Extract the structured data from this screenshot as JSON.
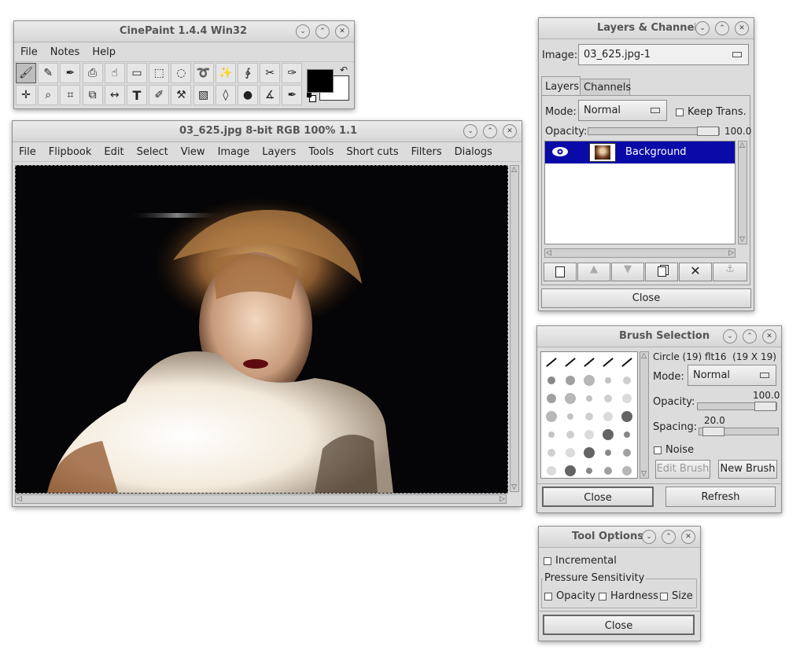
{
  "toolbox": {
    "title": "CinePaint 1.4.4 Win32",
    "menu": [
      "File",
      "Notes",
      "Help"
    ],
    "tools_row1": [
      "paintbrush-icon",
      "pencil-icon",
      "airbrush-icon",
      "clone-stamp-icon",
      "smudge-icon",
      "eraser-icon",
      "rect-select-icon",
      "ellipse-select-icon",
      "lasso-icon",
      "magic-wand-icon",
      "bezier-select-icon",
      "scissors-icon",
      "ink-pen-icon"
    ],
    "tools_row2": [
      "move-icon",
      "zoom-icon",
      "crop-icon",
      "transform-icon",
      "flip-icon",
      "text-icon",
      "color-picker-icon",
      "bucket-fill-icon",
      "gradient-icon",
      "blur-icon",
      "dodge-burn-icon",
      "measure-icon",
      "spline-icon"
    ],
    "fg_color": "#000000",
    "bg_color": "#ffffff"
  },
  "image_window": {
    "title": "03_625.jpg 8-bit RGB 100% 1.1",
    "menu": [
      "File",
      "Flipbook",
      "Edit",
      "Select",
      "View",
      "Image",
      "Layers",
      "Tools",
      "Short cuts",
      "Filters",
      "Dialogs"
    ]
  },
  "layers": {
    "title": "Layers & Channels",
    "image_label": "Image:",
    "image_value": "03_625.jpg-1",
    "tabs": [
      "Layers",
      "Channels"
    ],
    "mode_label": "Mode:",
    "mode_value": "Normal",
    "keep_trans": "Keep Trans.",
    "opacity_label": "Opacity:",
    "opacity_value": "100.0",
    "layer_name": "Background",
    "close": "Close"
  },
  "brush": {
    "title": "Brush Selection",
    "brush_info": "Circle (19) flt16",
    "brush_size": "(19 X 19)",
    "mode_label": "Mode:",
    "mode_value": "Normal",
    "opacity_label": "Opacity:",
    "opacity_value": "100.0",
    "spacing_label": "Spacing:",
    "spacing_value": "20.0",
    "noise": "Noise",
    "edit_brush": "Edit Brush",
    "new_brush": "New Brush",
    "close": "Close",
    "refresh": "Refresh"
  },
  "tool_options": {
    "title": "Tool Options",
    "incremental": "Incremental",
    "pressure": "Pressure Sensitivity",
    "opacity": "Opacity",
    "hardness": "Hardness",
    "size": "Size",
    "close": "Close"
  },
  "colors": {
    "selected_layer": "#0a0aa8"
  }
}
